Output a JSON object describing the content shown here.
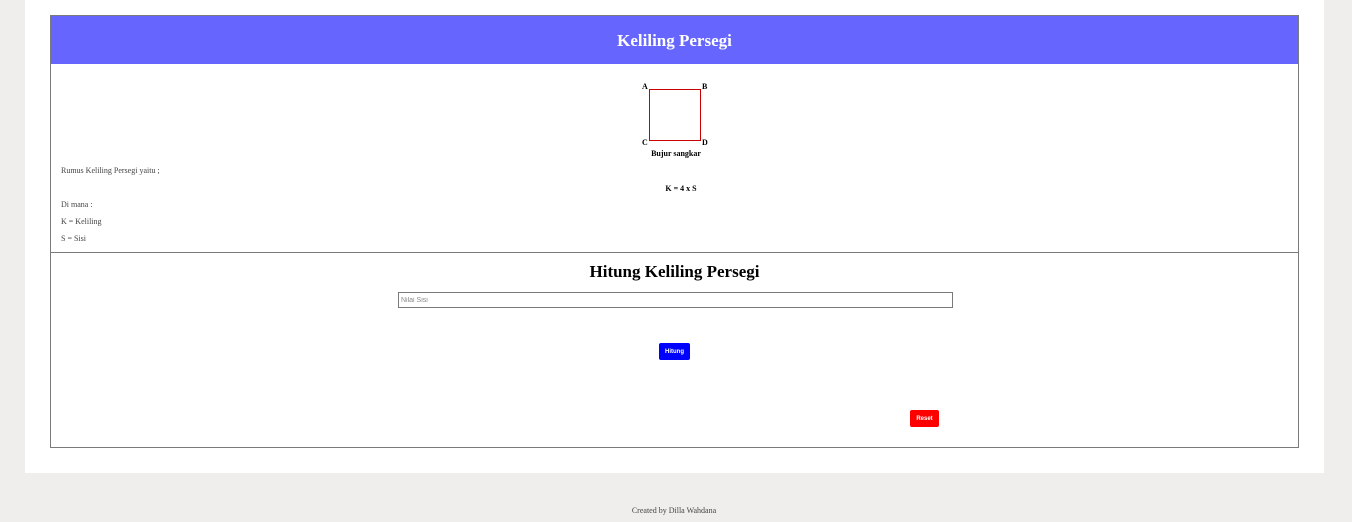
{
  "header": {
    "title": "Keliling Persegi"
  },
  "figure": {
    "vertices": [
      "A",
      "B",
      "C",
      "D"
    ],
    "caption": "Bujur sangkar"
  },
  "explanation": {
    "intro": "Rumus Keliling Persegi yaitu ;",
    "formula": "K = 4 x S",
    "where_label": "Di mana :",
    "definitions": [
      "K = Keliling",
      "S = Sisi"
    ]
  },
  "calculator": {
    "title": "Hitung Keliling Persegi",
    "input_placeholder": "Nilai Sisi",
    "input_value": "",
    "calculate_label": "Hitung",
    "reset_label": "Reset"
  },
  "footer": {
    "credit": "Created by Dilla Wahdana"
  },
  "colors": {
    "header_bg": "#6666ff",
    "square_border": "#cc0000",
    "calculate_button": "#0000ff",
    "reset_button": "#ff0000",
    "page_bg": "#efeeec"
  },
  "icons": {
    "square_figure": "square-diagram-icon"
  }
}
